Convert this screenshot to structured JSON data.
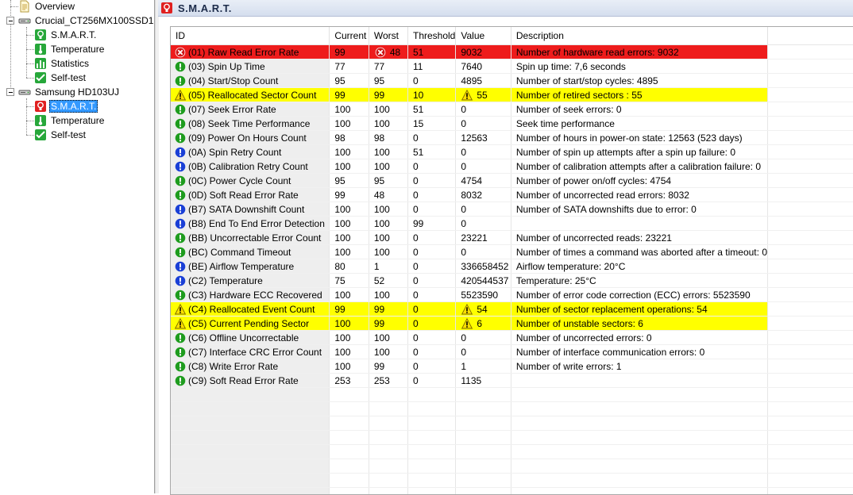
{
  "tree": {
    "overview": "Overview",
    "drive1": {
      "name": "Crucial_CT256MX100SSD1",
      "items": [
        "S.M.A.R.T.",
        "Temperature",
        "Statistics",
        "Self-test"
      ]
    },
    "drive2": {
      "name": "Samsung HD103UJ",
      "items": [
        "S.M.A.R.T.",
        "Temperature",
        "Self-test"
      ],
      "selected_index": 0
    }
  },
  "header": {
    "title": "S.M.A.R.T."
  },
  "table": {
    "columns": [
      "ID",
      "Current",
      "Worst",
      "Threshold",
      "Value",
      "Description"
    ],
    "rows": [
      {
        "status": "error",
        "id": "(01) Raw Read Error Rate",
        "current": "99",
        "worst": "48",
        "worst_icon": "error",
        "threshold": "51",
        "value": "9032",
        "value_icon": "",
        "description": "Number of hardware read errors: 9032"
      },
      {
        "status": "ok",
        "id": "(03) Spin Up Time",
        "current": "77",
        "worst": "77",
        "threshold": "11",
        "value": "7640",
        "description": "Spin up time: 7,6 seconds"
      },
      {
        "status": "ok",
        "id": "(04) Start/Stop Count",
        "current": "95",
        "worst": "95",
        "threshold": "0",
        "value": "4895",
        "description": "Number of start/stop cycles: 4895"
      },
      {
        "status": "warning",
        "id": "(05) Reallocated Sector Count",
        "current": "99",
        "worst": "99",
        "threshold": "10",
        "value": "55",
        "value_icon": "warning",
        "description": "Number of retired sectors : 55"
      },
      {
        "status": "ok",
        "id": "(07) Seek Error Rate",
        "current": "100",
        "worst": "100",
        "threshold": "51",
        "value": "0",
        "description": "Number of seek errors: 0"
      },
      {
        "status": "ok",
        "id": "(08) Seek Time Performance",
        "current": "100",
        "worst": "100",
        "threshold": "15",
        "value": "0",
        "description": "Seek time performance"
      },
      {
        "status": "ok",
        "id": "(09) Power On Hours Count",
        "current": "98",
        "worst": "98",
        "threshold": "0",
        "value": "12563",
        "description": "Number of hours in power-on state: 12563 (523 days)"
      },
      {
        "status": "info",
        "id": "(0A) Spin Retry Count",
        "current": "100",
        "worst": "100",
        "threshold": "51",
        "value": "0",
        "description": "Number of spin up attempts after a spin up failure: 0"
      },
      {
        "status": "info",
        "id": "(0B) Calibration Retry Count",
        "current": "100",
        "worst": "100",
        "threshold": "0",
        "value": "0",
        "description": "Number of calibration attempts after a calibration failure: 0"
      },
      {
        "status": "ok",
        "id": "(0C) Power Cycle Count",
        "current": "95",
        "worst": "95",
        "threshold": "0",
        "value": "4754",
        "description": "Number of power on/off cycles: 4754"
      },
      {
        "status": "ok",
        "id": "(0D) Soft Read Error Rate",
        "current": "99",
        "worst": "48",
        "threshold": "0",
        "value": "8032",
        "description": "Number of uncorrected read errors: 8032"
      },
      {
        "status": "info",
        "id": "(B7) SATA Downshift Count",
        "current": "100",
        "worst": "100",
        "threshold": "0",
        "value": "0",
        "description": "Number of SATA downshifts due to error: 0"
      },
      {
        "status": "info",
        "id": "(B8) End To End Error Detection",
        "current": "100",
        "worst": "100",
        "threshold": "99",
        "value": "0",
        "description": ""
      },
      {
        "status": "ok",
        "id": "(BB) Uncorrectable Error Count",
        "current": "100",
        "worst": "100",
        "threshold": "0",
        "value": "23221",
        "description": "Number of uncorrected reads: 23221"
      },
      {
        "status": "ok",
        "id": "(BC) Command Timeout",
        "current": "100",
        "worst": "100",
        "threshold": "0",
        "value": "0",
        "description": "Number of times a command was aborted after a timeout: 0"
      },
      {
        "status": "info",
        "id": "(BE) Airflow Temperature",
        "current": "80",
        "worst": "1",
        "threshold": "0",
        "value": "336658452",
        "description": "Airflow temperature: 20°C"
      },
      {
        "status": "info",
        "id": "(C2) Temperature",
        "current": "75",
        "worst": "52",
        "threshold": "0",
        "value": "420544537",
        "description": "Temperature: 25°C"
      },
      {
        "status": "ok",
        "id": "(C3) Hardware ECC Recovered",
        "current": "100",
        "worst": "100",
        "threshold": "0",
        "value": "5523590",
        "description": "Number of error code correction (ECC) errors: 5523590"
      },
      {
        "status": "warning",
        "id": "(C4) Reallocated Event Count",
        "current": "99",
        "worst": "99",
        "threshold": "0",
        "value": "54",
        "value_icon": "warning",
        "description": "Number of sector replacement operations: 54"
      },
      {
        "status": "warning",
        "id": "(C5) Current Pending Sector",
        "current": "100",
        "worst": "99",
        "threshold": "0",
        "value": "6",
        "value_icon": "warning",
        "description": "Number of unstable sectors: 6"
      },
      {
        "status": "ok",
        "id": "(C6) Offline Uncorrectable",
        "current": "100",
        "worst": "100",
        "threshold": "0",
        "value": "0",
        "description": "Number of uncorrected errors: 0"
      },
      {
        "status": "ok",
        "id": "(C7) Interface CRC Error Count",
        "current": "100",
        "worst": "100",
        "threshold": "0",
        "value": "0",
        "description": "Number of interface communication errors: 0"
      },
      {
        "status": "ok",
        "id": "(C8) Write Error Rate",
        "current": "100",
        "worst": "99",
        "threshold": "0",
        "value": "1",
        "description": "Number of write errors: 1"
      },
      {
        "status": "ok",
        "id": "(C9) Soft Read Error Rate",
        "current": "253",
        "worst": "253",
        "threshold": "0",
        "value": "1135",
        "description": ""
      }
    ]
  },
  "colors": {
    "error_row": "#ee1c1c",
    "warning_row": "#ffff00",
    "ok_icon": "#1e9c1e",
    "info_icon": "#1a3fd6",
    "selected": "#3399ff"
  }
}
